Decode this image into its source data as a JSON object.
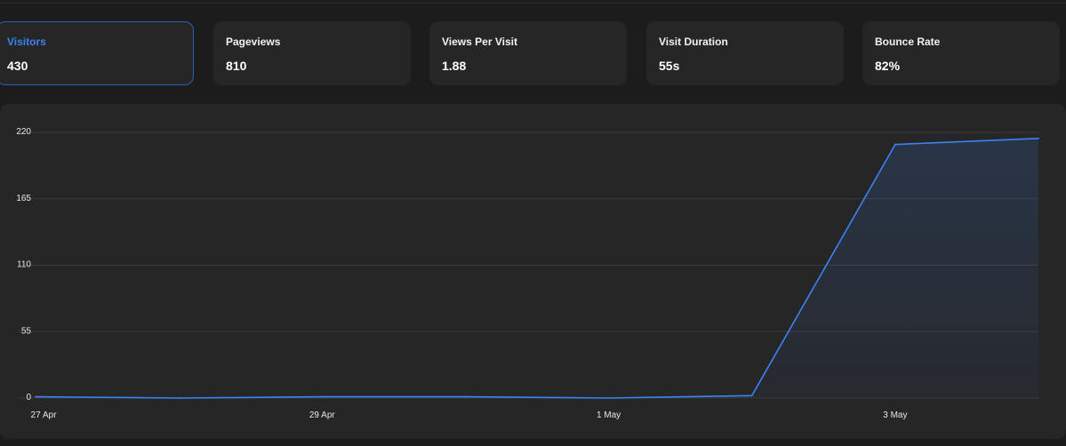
{
  "stats": [
    {
      "label": "Visitors",
      "value": "430",
      "active": true
    },
    {
      "label": "Pageviews",
      "value": "810",
      "active": false
    },
    {
      "label": "Views Per Visit",
      "value": "1.88",
      "active": false
    },
    {
      "label": "Visit Duration",
      "value": "55s",
      "active": false
    },
    {
      "label": "Bounce Rate",
      "value": "82%",
      "active": false
    }
  ],
  "colors": {
    "accent": "#3b82f6",
    "background": "#1c1c1c",
    "card": "#262626",
    "grid": "#3a3a3a"
  },
  "chart_data": {
    "type": "area",
    "title": "",
    "xlabel": "",
    "ylabel": "",
    "ylim": [
      0,
      220
    ],
    "yticks": [
      0,
      55,
      110,
      165,
      220
    ],
    "x": [
      "27 Apr",
      "28 Apr",
      "29 Apr",
      "30 Apr",
      "1 May",
      "2 May",
      "3 May",
      "4 May"
    ],
    "xticks": [
      "27 Apr",
      "29 Apr",
      "1 May",
      "3 May"
    ],
    "series": [
      {
        "values": [
          1,
          0,
          1,
          1,
          0,
          2,
          210,
          215
        ]
      }
    ],
    "grid": true
  }
}
